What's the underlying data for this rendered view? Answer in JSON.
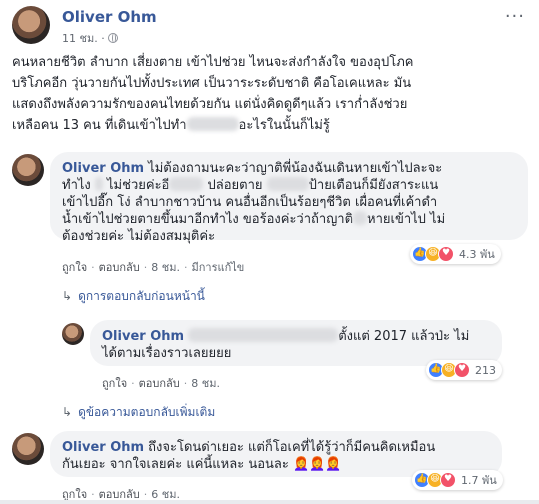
{
  "post": {
    "author": "Oliver Ohm",
    "time": "11 ชม. ·",
    "more": "···",
    "body_line1": "คนหลายชีวิต ลำบาก เสี่ยงตาย เข้าไปช่วย ไหนจะส่งกำลังใจ ของอุปโภค",
    "body_line2": "บริโภคอีก วุ่นวายกันไปทั้งประเทศ เป็นวาระระดับชาติ คือโอเคแหละ มัน",
    "body_line3": "แสดงถึงพลังความรักของคนไทยด้วยกัน แต่นั่งคิดดูดีๆแล้ว เราก่ำลังช่วย",
    "body_line4a": "เหลือคน 13 คน ที่เดินเข้าไปทำ",
    "body_line4b": "อะไรในนั้นก็ไม่รู้"
  },
  "comment1": {
    "author": "Oliver Ohm",
    "text_a": " ไม่ต้องถามนะคะว่าญาติพี่น้องฉันเดินหายเข้าไปละจะ",
    "text_b": "ทำไง ",
    "text_c": " ไม่ช่วยค่ะอี",
    "text_d": " ปล่อยตาย ",
    "text_e": "ป้ายเตือนก็มียังสาระแน",
    "text_f": "เข้าไปอี๊ก โง่ ลำบากชาวบ้าน คนอื่นอีกเป็นร้อยๆชีวิต เผื่อคนที่เค้าดำ",
    "text_g": "น้ำเข้าไปช่วยตายขึ้นมาอีกทำไง ขอร้องค่ะว่าถ้าญาติ",
    "text_h": "หายเข้าไป ไม่",
    "text_i": "ต้องช่วยค่ะ ไม่ต้องสมมุติค่ะ",
    "like": "ถูกใจ",
    "reply": "ตอบกลับ",
    "time": "8 ชม.",
    "edited": "มีการแก้ไข",
    "reaction_count": "4.3 พัน"
  },
  "view_prev_replies": "ดูการตอบกลับก่อนหน้านี้",
  "reply1": {
    "author": "Oliver Ohm",
    "text_a": "ตั้งแต่ 2017 แล้วป่ะ ไม่",
    "text_b": "ได้ตามเรื่องราวเลยยยย",
    "like": "ถูกใจ",
    "reply": "ตอบกลับ",
    "time": "8 ชม.",
    "reaction_count": "213"
  },
  "view_more_replies": "ดูข้อความตอบกลับเพิ่มเติม",
  "comment2": {
    "author": "Oliver Ohm",
    "text_a": " ถึงจะโดนด่าเยอะ แต่ก็โอเคที่ได้รู้ว่าก็มีคนคิดเหมือน",
    "text_b": "กันเยอะ จากใจเลยค่ะ แค่นี้แหละ นอนละ",
    "emoji": "👩‍🦰👩‍🦰👩‍🦰",
    "like": "ถูกใจ",
    "reply": "ตอบกลับ",
    "time": "6 ชม.",
    "reaction_count": "1.7 พัน"
  },
  "colors": {
    "link": "#385898",
    "bubble": "#f2f3f5",
    "like": "#4080ff",
    "haha": "#f7b125",
    "love": "#f25268"
  }
}
